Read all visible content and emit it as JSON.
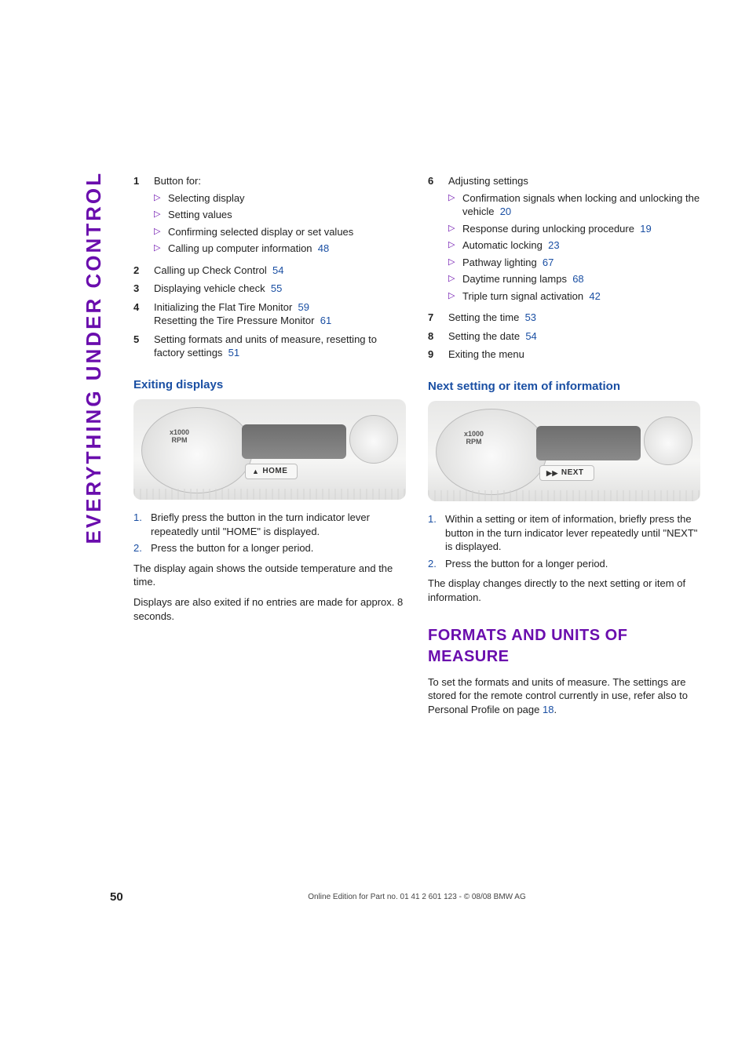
{
  "side_title": "EVERYTHING UNDER CONTROL",
  "page_number": "50",
  "footer_text": "Online Edition for Part no. 01 41 2 601 123  - © 08/08 BMW AG",
  "left": {
    "items": [
      {
        "num": "1",
        "text": "Button for:",
        "sub": [
          {
            "text": "Selecting display"
          },
          {
            "text": "Setting values"
          },
          {
            "text": "Confirming selected display or set values"
          },
          {
            "text": "Calling up computer information",
            "ref": "48"
          }
        ]
      },
      {
        "num": "2",
        "text": "Calling up Check Control",
        "ref": "54"
      },
      {
        "num": "3",
        "text": "Displaying vehicle check",
        "ref": "55"
      },
      {
        "num": "4",
        "text": "Initializing the Flat Tire Monitor",
        "ref": "59",
        "text2": "Resetting the Tire Pressure Monitor",
        "ref2": "61"
      },
      {
        "num": "5",
        "text": "Setting formats and units of measure, resetting to factory settings",
        "ref": "51"
      }
    ],
    "section1": {
      "heading": "Exiting displays",
      "fig_rpm_top": "x1000",
      "fig_rpm_bot": "RPM",
      "fig_label": "HOME",
      "fig_glyph": "▲",
      "steps": [
        {
          "n": "1.",
          "t": "Briefly press the button in the turn indicator lever repeatedly until \"HOME\" is displayed."
        },
        {
          "n": "2.",
          "t": "Press the button for a longer period."
        }
      ],
      "p1": "The display again shows the outside temperature and the time.",
      "p2": "Displays are also exited if no entries are made for approx. 8 seconds."
    }
  },
  "right": {
    "items": [
      {
        "num": "6",
        "text": "Adjusting settings",
        "sub": [
          {
            "text": "Confirmation signals when locking and unlocking the vehicle",
            "ref": "20"
          },
          {
            "text": "Response during unlocking procedure",
            "ref": "19"
          },
          {
            "text": "Automatic locking",
            "ref": "23"
          },
          {
            "text": "Pathway lighting",
            "ref": "67"
          },
          {
            "text": "Daytime running lamps",
            "ref": "68"
          },
          {
            "text": "Triple turn signal activation",
            "ref": "42"
          }
        ]
      },
      {
        "num": "7",
        "text": "Setting the time",
        "ref": "53"
      },
      {
        "num": "8",
        "text": "Setting the date",
        "ref": "54"
      },
      {
        "num": "9",
        "text": "Exiting the menu"
      }
    ],
    "section1": {
      "heading": "Next setting or item of information",
      "fig_rpm_top": "x1000",
      "fig_rpm_bot": "RPM",
      "fig_label": "NEXT",
      "fig_glyph": "▶▶",
      "steps": [
        {
          "n": "1.",
          "t": "Within a setting or item of information, briefly press the button in the turn indicator lever repeatedly until \"NEXT\" is displayed."
        },
        {
          "n": "2.",
          "t": "Press the button for a longer period."
        }
      ],
      "p1": "The display changes directly to the next setting or item of information."
    },
    "major": {
      "heading": "Formats and units of measure",
      "p_pre": "To set the formats and units of measure. The settings are stored for the remote control currently in use, refer also to Personal Profile on page ",
      "ref": "18",
      "p_post": "."
    }
  }
}
